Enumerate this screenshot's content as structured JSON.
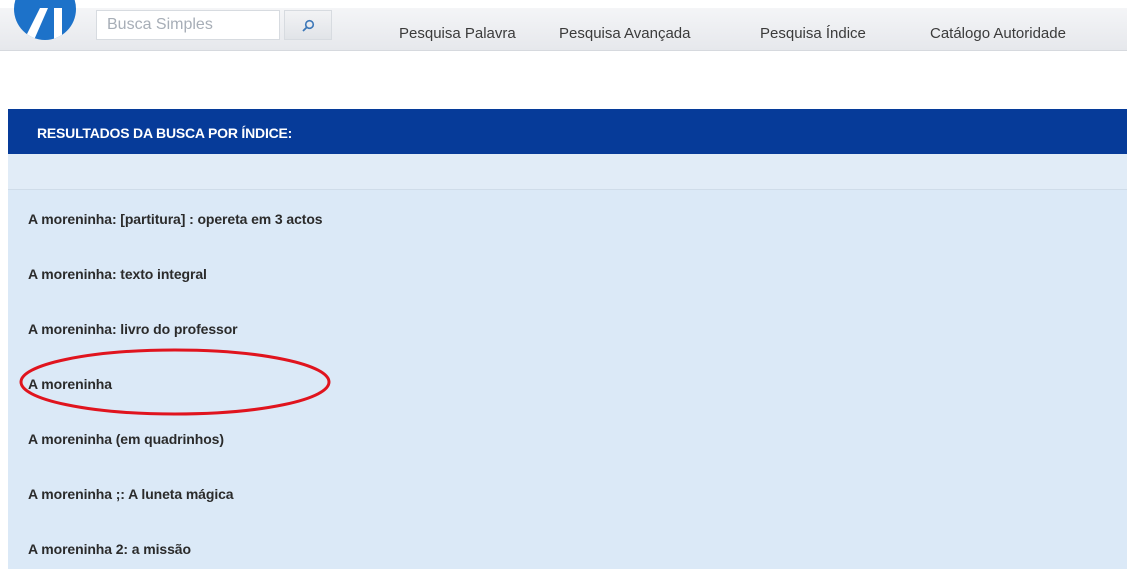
{
  "search": {
    "placeholder": "Busca Simples",
    "value": ""
  },
  "nav": {
    "items": [
      {
        "label": "Pesquisa Palavra"
      },
      {
        "label": "Pesquisa Avançada"
      },
      {
        "label": "Pesquisa Índice"
      },
      {
        "label": "Catálogo Autoridade"
      }
    ]
  },
  "results": {
    "title": "RESULTADOS DA BUSCA POR ÍNDICE:",
    "items": [
      {
        "label": "A moreninha: [partitura] : opereta em 3 actos"
      },
      {
        "label": "A moreninha: texto integral"
      },
      {
        "label": "A moreninha: livro do professor"
      },
      {
        "label": "A moreninha"
      },
      {
        "label": "A moreninha (em quadrinhos)"
      },
      {
        "label": "A moreninha ;: A luneta mágica"
      },
      {
        "label": "A moreninha 2: a missão"
      }
    ]
  },
  "colors": {
    "header_bg": "#063b99",
    "panel_bg": "#dbe9f7",
    "logo_blue": "#1d72c9",
    "highlight": "#e0141e"
  },
  "icons": {
    "logo": "logo-icon",
    "search": "search-icon"
  }
}
